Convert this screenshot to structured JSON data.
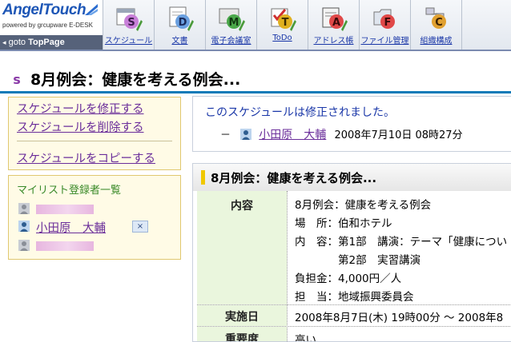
{
  "header": {
    "brand": "AngelTouch",
    "powered": "powered by grcupware E-DESK",
    "goto_arrow": "◂",
    "goto_label": "goto",
    "toppage": "TopPage",
    "nav": [
      {
        "label": "スケジュール",
        "icon": "schedule-calendar-icon",
        "letter": "S",
        "color": "#c87fd8"
      },
      {
        "label": "文書",
        "icon": "document-icon",
        "letter": "D",
        "color": "#6aa0e0"
      },
      {
        "label": "電子会議室",
        "icon": "meeting-room-icon",
        "letter": "M",
        "color": "#4aa84a"
      },
      {
        "label": "ToDo",
        "icon": "todo-check-icon",
        "letter": "T",
        "color": "#e0b020"
      },
      {
        "label": "アドレス帳",
        "icon": "address-book-icon",
        "letter": "A",
        "color": "#e04848"
      },
      {
        "label": "ファイル管理",
        "icon": "file-management-icon",
        "letter": "F",
        "color": "#e04848"
      },
      {
        "label": "組織構成",
        "icon": "organization-icon",
        "letter": "C",
        "color": "#e0a030"
      }
    ]
  },
  "page": {
    "title": "8月例会：健康を考える例会..."
  },
  "actions": {
    "edit": "スケジュールを修正する",
    "delete": "スケジュールを削除する",
    "copy": "スケジュールをコピーする"
  },
  "mylist": {
    "heading": "マイリスト登録者一覧",
    "member2_name": "小田原　大輔",
    "remove_label": "×"
  },
  "notice": {
    "message": "このスケジュールは修正されました。",
    "dash": "－",
    "user": "小田原　大輔",
    "datetime": "2008年7月10日 08時27分"
  },
  "detail": {
    "title": "8月例会：健康を考える例会...",
    "content_label": "内容",
    "content_lines": [
      "8月例会：健康を考える例会",
      "場　所：伯和ホテル",
      "内　容：第1部　講演：テーマ「健康につい",
      "　　　　第2部　実習講演",
      "負担金：4,000円／人",
      "担　当：地域振興委員会"
    ],
    "date_label": "実施日",
    "date_value": "2008年8月7日(木) 19時00分 ～ 2008年8",
    "priority_label": "重要度",
    "priority_value": "高い"
  },
  "colors": {
    "link_visited": "#6a2d9a",
    "notice_text": "#1a37a8",
    "title_rule": "#0d7ab8",
    "panel_bg": "#fffbe6",
    "label_bg": "#eaf6dd"
  }
}
